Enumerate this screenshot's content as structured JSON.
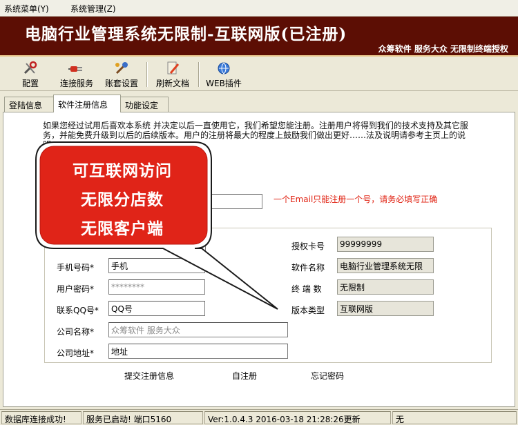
{
  "menu": {
    "items": [
      {
        "label": "系统菜单(Y)"
      },
      {
        "label": "系统管理(Z)"
      }
    ]
  },
  "banner": {
    "title": "电脑行业管理系统无限制-互联网版(已注册)",
    "subtitle": "众筹软件  服务大众  无限制终端授权"
  },
  "toolbar": {
    "buttons": [
      {
        "label": "配置",
        "icon": "tools-icon"
      },
      {
        "label": "连接服务",
        "icon": "plug-icon"
      },
      {
        "label": "账套设置",
        "icon": "wrench-icon"
      },
      {
        "label": "刷新文档",
        "icon": "pencil-icon"
      },
      {
        "label": "WEB插件",
        "icon": "globe-icon"
      }
    ]
  },
  "tabs": [
    {
      "label": "登陆信息"
    },
    {
      "label": "软件注册信息"
    },
    {
      "label": "功能设定"
    }
  ],
  "intro": {
    "text": "如果您经过试用后喜欢本系统 并决定以后一直使用它，我们希望您能注册。注册用户将得到我们的技术支持及其它服务，并能免费升级到以后的后续版本。用户的注册将最大的程度上鼓励我们做出更好……法及说明请参考主页上的说明。"
  },
  "email": {
    "value": "",
    "hint": "一个Email只能注册一个号，请务必填写正确"
  },
  "form": {
    "phone": {
      "label": "手机号码*",
      "value": "手机"
    },
    "password": {
      "label": "用户密码*",
      "value": "********"
    },
    "qq": {
      "label": "联系QQ号*",
      "value": "QQ号"
    },
    "company": {
      "label": "公司名称*",
      "value": "众筹软件 服务大众"
    },
    "address": {
      "label": "公司地址*",
      "value": "地址"
    }
  },
  "info": {
    "auth_card": {
      "label": "授权卡号",
      "value": "99999999"
    },
    "software": {
      "label": "软件名称",
      "value": "电脑行业管理系统无限"
    },
    "terminals": {
      "label": "终 端 数",
      "value": "无限制"
    },
    "version_type": {
      "label": "版本类型",
      "value": "互联网版"
    }
  },
  "actions": {
    "submit": "提交注册信息",
    "self_register": "自注册",
    "forgot": "忘记密码"
  },
  "status": {
    "db": "数据库连接成功!",
    "service": "服务已启动! 端口5160",
    "version": "Ver:1.0.4.3 2016-03-18 21:28:26更新",
    "extra": "无"
  },
  "callout": {
    "lines": [
      "可互联网访问",
      "无限分店数",
      "无限客户端"
    ]
  },
  "colors": {
    "banner_bg": "#5c0e04",
    "callout_fill": "#e02418",
    "hint_text": "#e02010"
  }
}
